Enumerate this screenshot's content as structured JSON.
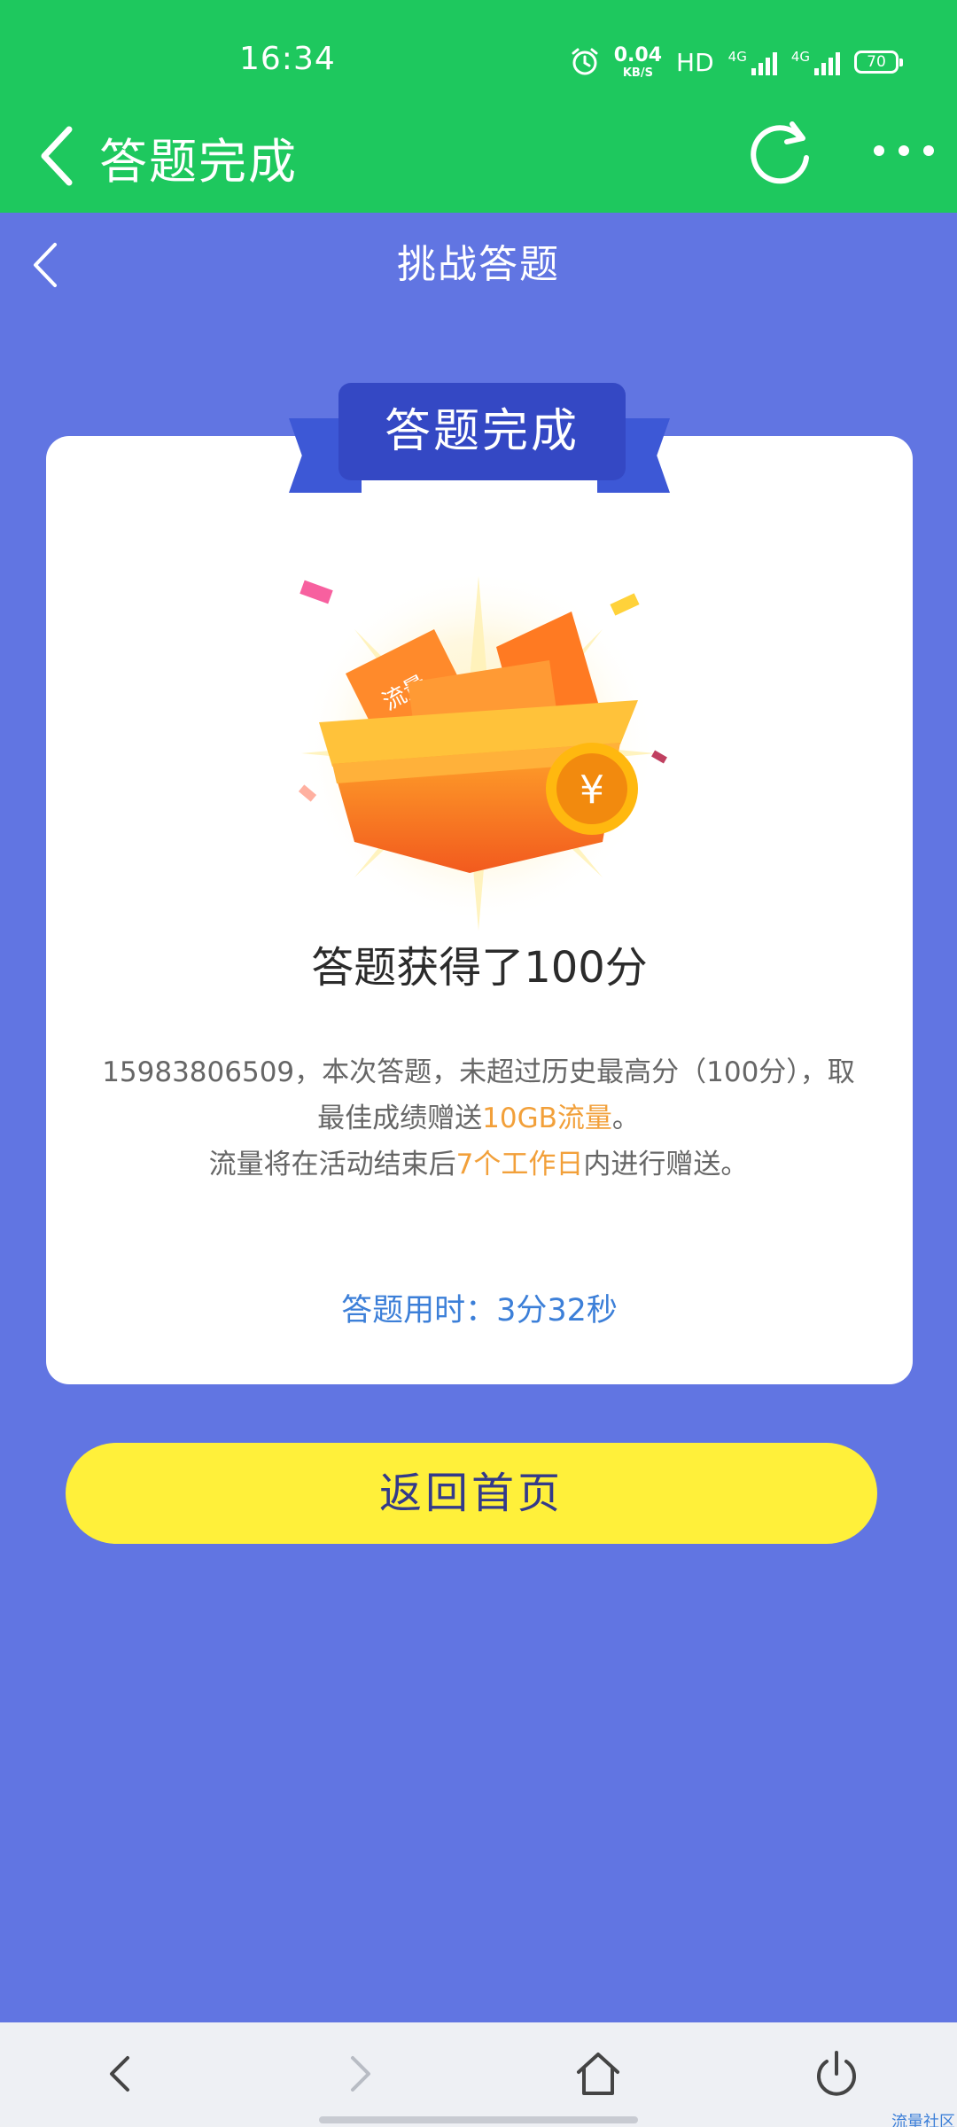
{
  "status_bar": {
    "time": "16:34",
    "net_speed_value": "0.04",
    "net_speed_unit": "KB/S",
    "hd": "HD",
    "sim1_label": "4G",
    "sim2_label": "4G",
    "battery": "70",
    "icons": [
      "alarm-icon",
      "signal-icon",
      "battery-icon"
    ]
  },
  "app_bar": {
    "title": "答题完成",
    "back_icon": "chevron-left-icon",
    "refresh_icon": "refresh-icon",
    "more_icon": "more-icon"
  },
  "page": {
    "title": "挑战答题",
    "back_icon": "chevron-left-icon"
  },
  "card": {
    "ribbon": "答题完成",
    "gift_labels": [
      "流量",
      "流量"
    ],
    "coin_symbol": "¥",
    "score_text": "答题获得了100分",
    "desc_line1": "15983806509，本次答题，未超过历史最高分（100分），取",
    "desc_line2_prefix": "最佳成绩赠送",
    "desc_line2_highlight": "10GB流量",
    "desc_line2_suffix": "。",
    "desc_line3_prefix": "流量将在活动结束后",
    "desc_line3_highlight": "7个工作日",
    "desc_line3_suffix": "内进行赠送。",
    "timer": "答题用时：3分32秒"
  },
  "home_button": "返回首页",
  "bottom_nav": {
    "icons": [
      "back-icon",
      "forward-icon",
      "home-icon",
      "power-icon"
    ]
  },
  "watermark": "流量社区",
  "colors": {
    "status_green": "#1ec85e",
    "page_blue": "#6175e2",
    "ribbon_blue": "#3448c4",
    "highlight_orange": "#f2a03a",
    "timer_blue": "#3c7fd8",
    "button_yellow": "#fff03a"
  }
}
